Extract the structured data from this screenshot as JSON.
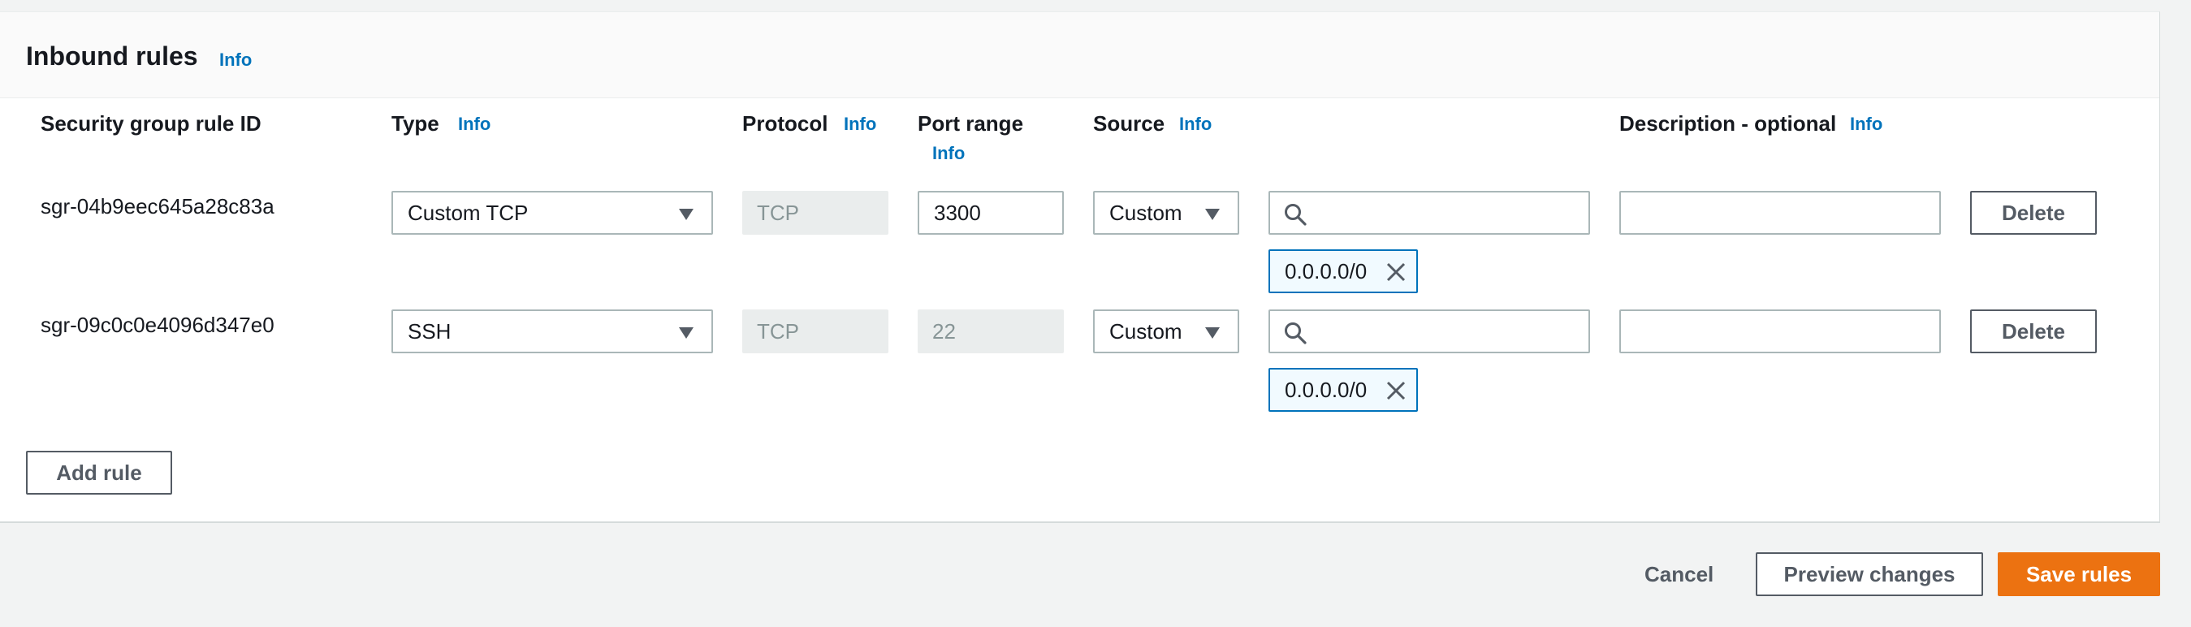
{
  "section": {
    "title": "Inbound rules",
    "info_label": "Info"
  },
  "columns": {
    "rule_id": "Security group rule ID",
    "type": "Type",
    "protocol": "Protocol",
    "port_range": "Port range",
    "source": "Source",
    "description": "Description - optional",
    "info_label": "Info"
  },
  "rules": [
    {
      "id": "sgr-04b9eec645a28c83a",
      "type": "Custom TCP",
      "protocol": "TCP",
      "port_range": "3300",
      "source_type": "Custom",
      "source_search_value": "",
      "source_token": "0.0.0.0/0",
      "description": "",
      "delete_label": "Delete"
    },
    {
      "id": "sgr-09c0c0e4096d347e0",
      "type": "SSH",
      "protocol": "TCP",
      "port_range": "22",
      "source_type": "Custom",
      "source_search_value": "",
      "source_token": "0.0.0.0/0",
      "description": "",
      "delete_label": "Delete"
    }
  ],
  "add_rule_label": "Add rule",
  "footer": {
    "cancel_label": "Cancel",
    "preview_label": "Preview changes",
    "save_label": "Save rules"
  },
  "colors": {
    "info_link": "#0073bb",
    "primary_button": "#ec7211",
    "token_border": "#0073bb",
    "token_background": "#f1faff"
  },
  "icons": {
    "dropdown": "caret-down-icon",
    "search": "search-icon",
    "remove_token": "close-icon"
  }
}
